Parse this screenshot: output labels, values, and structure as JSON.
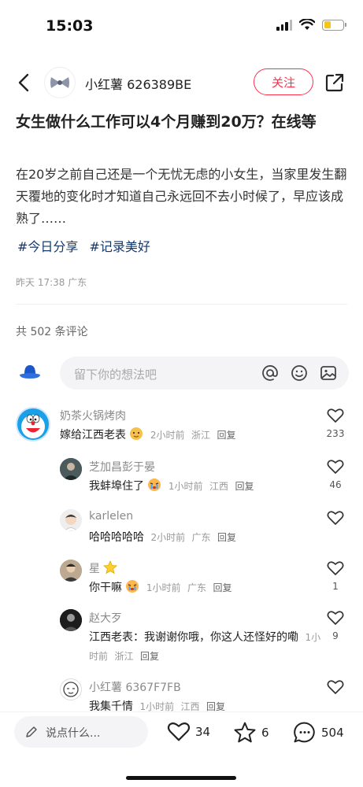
{
  "status_bar": {
    "time": "15:03",
    "battery_level": 0.35
  },
  "header": {
    "author_name": "小红薯 626389BE",
    "follow_label": "关注"
  },
  "post": {
    "title": "女生做什么工作可以4个月赚到20万？在线等",
    "body": "在20岁之前自己还是一个无忧无虑的小女生，当家里发生翻天覆地的变化时才知道自己永远回不去小时候了，早应该成熟了……",
    "tags": [
      "#今日分享",
      "#记录美好"
    ],
    "meta": "昨天 17:38 广东"
  },
  "comments_section": {
    "count_label": "共 502 条评论",
    "input_placeholder": "留下你的想法吧"
  },
  "comments": [
    {
      "user": "奶茶火锅烤肉",
      "text": "嫁给江西老表",
      "time": "2小时前",
      "location": "浙江",
      "reply": "回复",
      "likes": "233"
    },
    {
      "user": "芝加昌彭于晏",
      "text": "我蚌埠住了",
      "time": "1小时前",
      "location": "江西",
      "reply": "回复",
      "likes": "46"
    },
    {
      "user": "karlelen",
      "text": "哈哈哈哈哈",
      "time": "2小时前",
      "location": "广东",
      "reply": "回复",
      "likes": ""
    },
    {
      "user": "星",
      "text": "你干嘛",
      "time": "1小时前",
      "location": "广东",
      "reply": "回复",
      "likes": "1"
    },
    {
      "user": "赵大歹",
      "text": "江西老表：我谢谢你哦，你这人还怪好的嘞",
      "time": "1小时前",
      "location": "浙江",
      "reply": "回复",
      "likes": "9"
    },
    {
      "user": "小红薯 6367F7FB",
      "text": "我集千情",
      "time": "1小时前",
      "location": "江西",
      "reply": "回复",
      "likes": ""
    }
  ],
  "bottom_bar": {
    "input_placeholder": "说点什么...",
    "likes": "34",
    "favorites": "6",
    "comments": "504"
  },
  "colors": {
    "accent": "#ff2e4d",
    "tag": "#13386c"
  }
}
